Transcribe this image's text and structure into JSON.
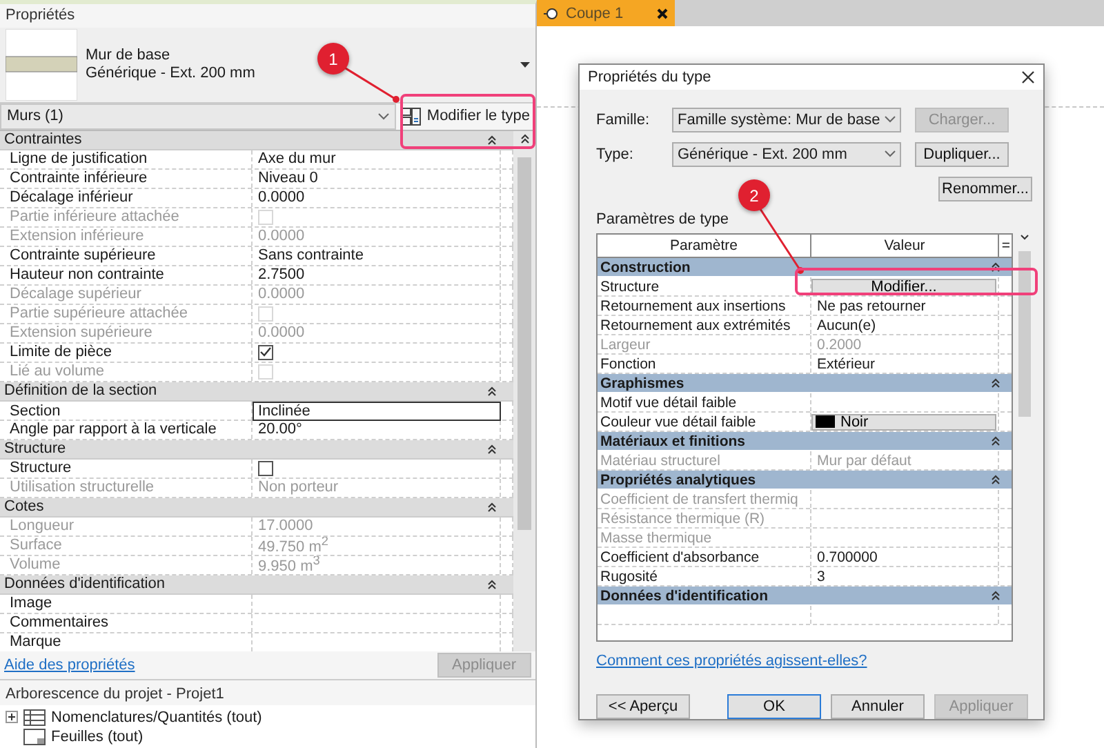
{
  "properties_panel": {
    "title": "Propriétés",
    "type_selector": {
      "family": "Mur de base",
      "type": "Générique - Ext. 200 mm"
    },
    "filter": "Murs (1)",
    "edit_type_button": "Modifier le type",
    "groups": [
      {
        "name": "Contraintes",
        "rows": [
          {
            "label": "Ligne de justification",
            "value": "Axe du mur",
            "kind": "text",
            "disabled": false
          },
          {
            "label": "Contrainte inférieure",
            "value": "Niveau 0",
            "kind": "text",
            "disabled": false
          },
          {
            "label": "Décalage inférieur",
            "value": "0.0000",
            "kind": "text",
            "disabled": false
          },
          {
            "label": "Partie inférieure attachée",
            "kind": "checkbox",
            "checked": false,
            "disabled": true
          },
          {
            "label": "Extension inférieure",
            "value": "0.0000",
            "kind": "text",
            "disabled": true
          },
          {
            "label": "Contrainte supérieure",
            "value": "Sans contrainte",
            "kind": "text",
            "disabled": false
          },
          {
            "label": "Hauteur non contrainte",
            "value": "2.7500",
            "kind": "text",
            "disabled": false
          },
          {
            "label": "Décalage supérieur",
            "value": "0.0000",
            "kind": "text",
            "disabled": true
          },
          {
            "label": "Partie supérieure attachée",
            "kind": "checkbox",
            "checked": false,
            "disabled": true
          },
          {
            "label": "Extension supérieure",
            "value": "0.0000",
            "kind": "text",
            "disabled": true
          },
          {
            "label": "Limite de pièce",
            "kind": "checkbox",
            "checked": true,
            "disabled": false
          },
          {
            "label": "Lié au volume",
            "kind": "checkbox",
            "checked": false,
            "disabled": true
          }
        ]
      },
      {
        "name": "Définition de la section",
        "rows": [
          {
            "label": "Section",
            "value": "Inclinée",
            "kind": "field",
            "disabled": false
          },
          {
            "label": "Angle par rapport à la verticale",
            "value": "20.00°",
            "kind": "text",
            "disabled": false
          }
        ]
      },
      {
        "name": "Structure",
        "rows": [
          {
            "label": "Structure",
            "kind": "checkbox",
            "checked": false,
            "disabled": false
          },
          {
            "label": "Utilisation structurelle",
            "value": "Non porteur",
            "kind": "text",
            "disabled": true
          }
        ]
      },
      {
        "name": "Cotes",
        "rows": [
          {
            "label": "Longueur",
            "value": "17.0000",
            "kind": "text",
            "disabled": true
          },
          {
            "label": "Surface",
            "value": "49.750 m$^{2}$",
            "kind": "text",
            "disabled": true
          },
          {
            "label": "Volume",
            "value": "9.950 m$^{3}$",
            "kind": "text",
            "disabled": true
          }
        ]
      },
      {
        "name": "Données d'identification",
        "rows": [
          {
            "label": "Image",
            "kind": "text",
            "disabled": false
          },
          {
            "label": "Commentaires",
            "kind": "text",
            "disabled": false
          },
          {
            "label": "Marque",
            "kind": "text",
            "disabled": false
          }
        ]
      }
    ],
    "help_link": "Aide des propriétés",
    "apply_button": {
      "label": "Appliquer",
      "disabled": true
    }
  },
  "project_browser": {
    "title": "Arborescence du projet - Projet1",
    "items": [
      {
        "label": "Nomenclatures/Quantités (tout)",
        "kind": "schedule",
        "expandable": true
      },
      {
        "label": "Feuilles (tout)",
        "kind": "sheet",
        "expandable": false
      }
    ]
  },
  "view_tab": {
    "label": "Coupe 1",
    "selected": true
  },
  "dialog": {
    "title": "Propriétés du type",
    "family_label": "Famille:",
    "family": "Famille système: Mur de base",
    "type_label": "Type:",
    "type": "Générique - Ext. 200 mm",
    "side_buttons": [
      {
        "label": "Charger...",
        "disabled": true
      },
      {
        "label": "Dupliquer...",
        "disabled": false
      },
      {
        "label": "Renommer...",
        "disabled": false
      }
    ],
    "section_label": "Paramètres de type",
    "columns": [
      "Paramètre",
      "Valeur",
      "="
    ],
    "groups": [
      {
        "name": "Construction",
        "rows": [
          {
            "label": "Structure",
            "value": "Modifier...",
            "kind": "button",
            "disabled": false
          },
          {
            "label": "Retournement aux insertions",
            "value": "Ne pas retourner",
            "kind": "text",
            "disabled": false
          },
          {
            "label": "Retournement aux extrémités",
            "value": "Aucun(e)",
            "kind": "text",
            "disabled": false
          },
          {
            "label": "Largeur",
            "value": "0.2000",
            "kind": "text",
            "disabled": true
          },
          {
            "label": "Fonction",
            "value": "Extérieur",
            "kind": "text",
            "disabled": false
          }
        ]
      },
      {
        "name": "Graphismes",
        "rows": [
          {
            "label": "Motif vue détail faible",
            "kind": "text",
            "disabled": false
          },
          {
            "label": "Couleur vue détail faible",
            "value": "Noir",
            "kind": "color",
            "color": "#000000",
            "disabled": false
          }
        ]
      },
      {
        "name": "Matériaux et finitions",
        "rows": [
          {
            "label": "Matériau structurel",
            "value": "Mur par défaut",
            "kind": "text",
            "disabled": true
          }
        ]
      },
      {
        "name": "Propriétés analytiques",
        "rows": [
          {
            "label": "Coefficient de transfert thermiq",
            "kind": "text",
            "disabled": true
          },
          {
            "label": "Résistance thermique (R)",
            "kind": "text",
            "disabled": true
          },
          {
            "label": "Masse thermique",
            "kind": "text",
            "disabled": true
          },
          {
            "label": "Coefficient d'absorbance",
            "value": "0.700000",
            "kind": "text",
            "disabled": false
          },
          {
            "label": "Rugosité",
            "value": "3",
            "kind": "text",
            "disabled": false
          }
        ]
      },
      {
        "name": "Données d'identification"
      }
    ],
    "help_link": "Comment ces propriétés agissent-elles?",
    "buttons": [
      {
        "label": "<< Aperçu",
        "disabled": false,
        "focused": false
      },
      {
        "label": "OK",
        "disabled": false,
        "focused": true
      },
      {
        "label": "Annuler",
        "disabled": false,
        "focused": false
      },
      {
        "label": "Appliquer",
        "disabled": true,
        "focused": false
      }
    ]
  },
  "callouts": [
    {
      "number": "1"
    },
    {
      "number": "2"
    }
  ]
}
